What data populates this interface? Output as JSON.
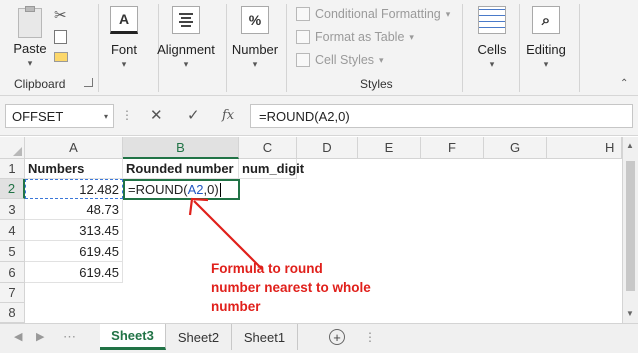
{
  "ribbon": {
    "clipboard": {
      "paste_label": "Paste",
      "group_label": "Clipboard"
    },
    "font": {
      "icon_letter": "A",
      "label": "Font"
    },
    "alignment": {
      "label": "Alignment"
    },
    "number": {
      "icon_symbol": "%",
      "label": "Number"
    },
    "styles": {
      "conditional_formatting": "Conditional Formatting",
      "format_as_table": "Format as Table",
      "cell_styles": "Cell Styles",
      "group_label": "Styles"
    },
    "cells": {
      "label": "Cells"
    },
    "editing": {
      "label": "Editing"
    }
  },
  "formula_bar": {
    "name_box": "OFFSET",
    "fx_label": "fx",
    "formula": "=ROUND(A2,0)"
  },
  "grid": {
    "columns": [
      "A",
      "B",
      "C",
      "D",
      "E",
      "F",
      "G",
      "H"
    ],
    "rows": [
      "1",
      "2",
      "3",
      "4",
      "5",
      "6",
      "7",
      "8"
    ],
    "header_row": {
      "a": "Numbers",
      "b": "Rounded number",
      "c": "num_digit"
    },
    "numbers": [
      "12.482",
      "48.73",
      "313.45",
      "619.45",
      "619.45"
    ],
    "edit_cell": {
      "prefix": "=ROUND(",
      "ref": "A2",
      "suffix": ",0)"
    }
  },
  "annotation": {
    "text": "Formula to round number nearest to whole number",
    "color": "#e0201b"
  },
  "sheet_tabs": [
    "Sheet3",
    "Sheet2",
    "Sheet1"
  ],
  "colors": {
    "accent_green": "#217346",
    "ref_blue": "#1f56c1",
    "annotation_red": "#e0201b"
  }
}
